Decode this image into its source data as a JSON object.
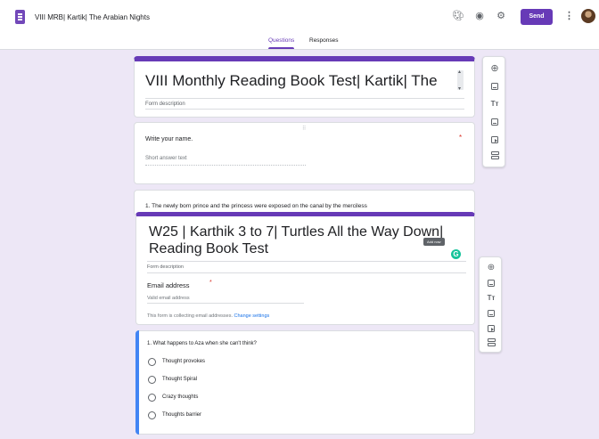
{
  "header": {
    "doc_title": "VIII MRB| Kartik| The Arabian Nights",
    "send_label": "Send",
    "more_glyph": "⋮"
  },
  "tabs": [
    {
      "label": "Questions",
      "active": true
    },
    {
      "label": "Responses",
      "active": false
    }
  ],
  "form1": {
    "title": "VIII Monthly Reading Book Test| Kartik| The",
    "description": "Form description",
    "drag_glyph": "⠿",
    "question": {
      "label": "Write your name.",
      "required_mark": "*",
      "placeholder": "Short answer text"
    },
    "next_question": "1. The newly born prince and the princess were exposed on the canal by the merciless"
  },
  "form2": {
    "title": "W25 | Karthik 3 to 7| Turtles All the Way Down| Reading Book Test",
    "description": "Form description",
    "tooltip": "Add now",
    "grammarly_letter": "G",
    "email": {
      "label": "Email address",
      "required_mark": "*",
      "placeholder": "Valid email address",
      "note": "This form is collecting email addresses.",
      "settings_link": "Change settings"
    },
    "question": {
      "label": "1. What happens to Aza when she can't think?",
      "options": [
        "Thought provokes",
        "Thought Spiral",
        "Crazy thoughts",
        "Thoughts barrier"
      ]
    }
  },
  "toolbar_items": [
    "add-question",
    "import-questions",
    "add-title",
    "add-image",
    "add-video",
    "add-section"
  ],
  "colors": {
    "accent": "#673ab7",
    "background": "#ede7f6",
    "focus_blue": "#4285f4",
    "required_red": "#d93025"
  }
}
